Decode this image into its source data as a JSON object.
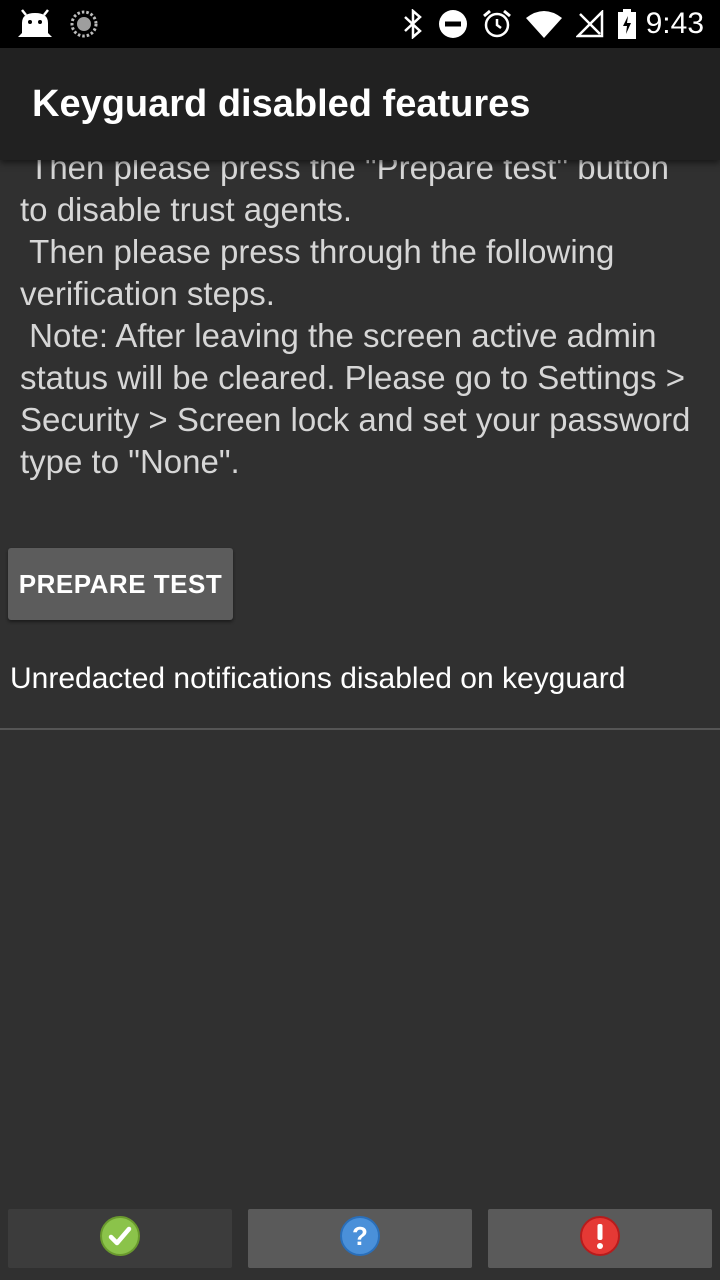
{
  "status_bar": {
    "time": "9:43",
    "icons_left": [
      "android-debug-icon",
      "sync-spinner-icon"
    ],
    "icons_right": [
      "bluetooth-icon",
      "do-not-disturb-icon",
      "alarm-icon",
      "wifi-icon",
      "no-signal-icon",
      "battery-charging-icon"
    ]
  },
  "app_bar": {
    "title": "Keyguard disabled features"
  },
  "instructions": {
    "text": "password to \"testpassword\".\n Then please press the \"Prepare test\" button to disable trust agents.\n Then please press through the following verification steps.\n Note: After leaving the screen active admin status will be cleared. Please go to Settings > Security > Screen lock and set your password type to \"None\"."
  },
  "prepare_button": {
    "label": "PREPARE TEST"
  },
  "test_status": {
    "text": "Unredacted notifications disabled on keyguard"
  },
  "bottom_buttons": {
    "pass_icon": "pass-check-icon",
    "info_icon": "info-question-icon",
    "fail_icon": "fail-exclamation-icon"
  },
  "colors": {
    "background": "#303030",
    "app_bar": "#212121",
    "button": "#5c5c5c",
    "pass": "#8bc34a",
    "info": "#4a90d9",
    "fail": "#e53935"
  }
}
